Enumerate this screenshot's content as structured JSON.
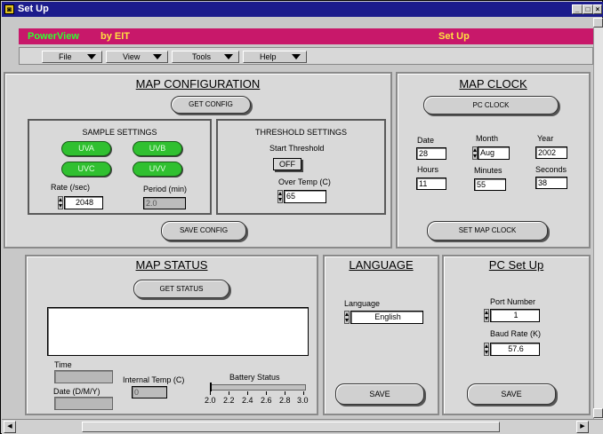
{
  "window": {
    "title": "Set Up",
    "icon": "window-app-icon"
  },
  "banner": {
    "product": "PowerView",
    "by": "by EIT",
    "section": "Set Up",
    "colors": {
      "bg": "#c8186a",
      "product": "#30ff30",
      "text": "#ffe040"
    }
  },
  "menu": [
    {
      "label": "File"
    },
    {
      "label": "View"
    },
    {
      "label": "Tools"
    },
    {
      "label": "Help"
    }
  ],
  "map_config": {
    "title": "MAP CONFIGURATION",
    "get_config": "GET CONFIG",
    "save_config": "SAVE CONFIG",
    "sample": {
      "title": "SAMPLE SETTINGS",
      "channels": [
        "UVA",
        "UVB",
        "UVC",
        "UVV"
      ],
      "rate_label": "Rate (/sec)",
      "rate_value": "2048",
      "period_label": "Period (min)",
      "period_value": "2.0"
    },
    "threshold": {
      "title": "THRESHOLD SETTINGS",
      "start_label": "Start Threshold",
      "start_value": "OFF",
      "over_temp_label": "Over Temp (C)",
      "over_temp_value": "65"
    }
  },
  "map_clock": {
    "title": "MAP CLOCK",
    "pc_clock": "PC CLOCK",
    "set_clock": "SET MAP CLOCK",
    "date_label": "Date",
    "date_value": "28",
    "month_label": "Month",
    "month_value": "Aug",
    "year_label": "Year",
    "year_value": "2002",
    "hours_label": "Hours",
    "hours_value": "11",
    "minutes_label": "Minutes",
    "minutes_value": "55",
    "seconds_label": "Seconds",
    "seconds_value": "38"
  },
  "map_status": {
    "title": "MAP STATUS",
    "get_status": "GET STATUS",
    "time_label": "Time",
    "date_label": "Date (D/M/Y)",
    "internal_temp_label": "Internal Temp (C)",
    "internal_temp_value": "0",
    "battery_label": "Battery Status",
    "battery_scale": [
      "2.0",
      "2.2",
      "2.4",
      "2.6",
      "2.8",
      "3.0"
    ]
  },
  "language": {
    "title": "LANGUAGE",
    "label": "Language",
    "value": "English",
    "save": "SAVE"
  },
  "pc_setup": {
    "title": "PC Set Up",
    "port_label": "Port Number",
    "port_value": "1",
    "baud_label": "Baud Rate (K)",
    "baud_value": "57.6",
    "save": "SAVE"
  }
}
